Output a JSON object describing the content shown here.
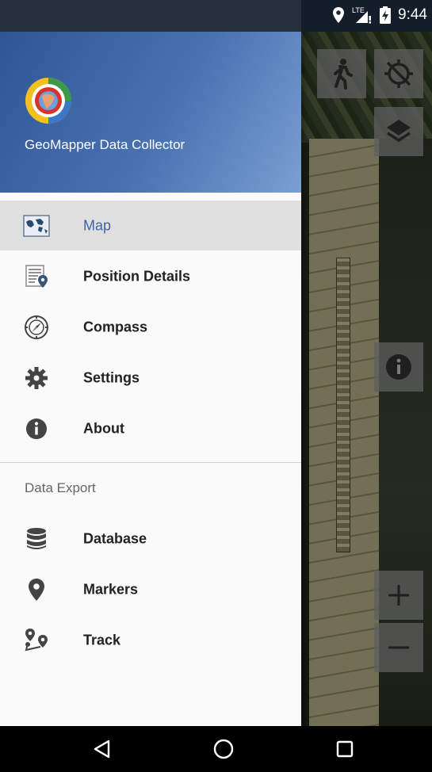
{
  "status_bar": {
    "network": "LTE",
    "time": "9:44"
  },
  "app": {
    "title": "GeoMapper Data Collector"
  },
  "menu": {
    "items": [
      {
        "label": "Map",
        "icon": "world-map-icon",
        "active": true
      },
      {
        "label": "Position Details",
        "icon": "position-details-icon",
        "active": false
      },
      {
        "label": "Compass",
        "icon": "compass-icon",
        "active": false
      },
      {
        "label": "Settings",
        "icon": "gear-icon",
        "active": false
      },
      {
        "label": "About",
        "icon": "info-icon",
        "active": false
      }
    ],
    "section_label": "Data Export",
    "export_items": [
      {
        "label": "Database",
        "icon": "database-icon"
      },
      {
        "label": "Markers",
        "icon": "marker-icon"
      },
      {
        "label": "Track",
        "icon": "track-icon"
      }
    ]
  },
  "colors": {
    "header_start": "#2f5596",
    "header_end": "#7a9fd3",
    "active_text": "#3f63a7",
    "active_bg": "#e0e0e0"
  }
}
